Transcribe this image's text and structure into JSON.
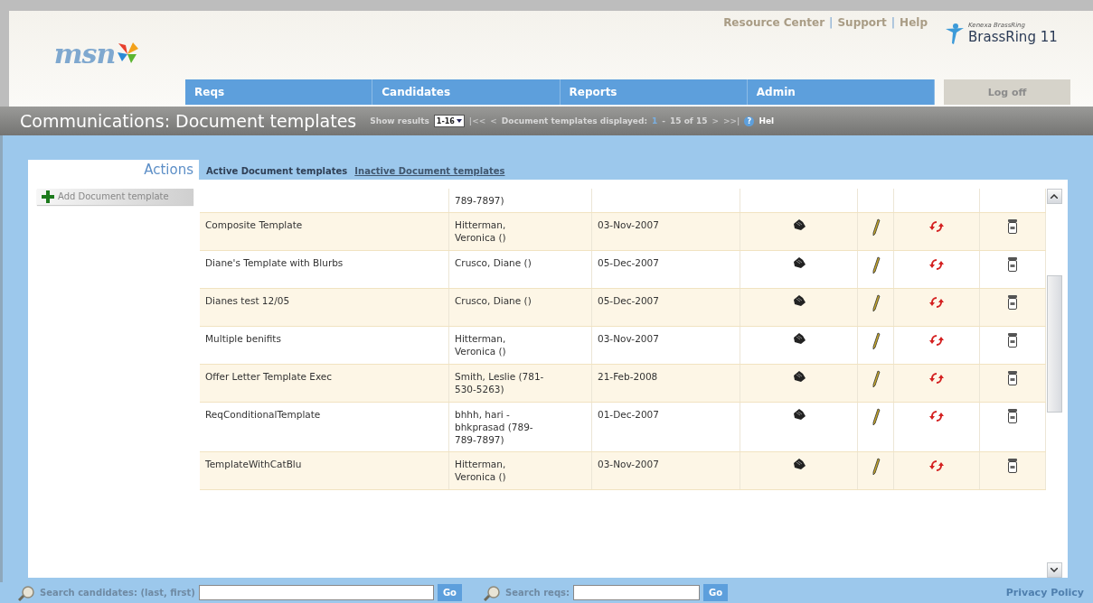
{
  "header": {
    "logo": "msn",
    "top_links": [
      {
        "label": "Resource Center",
        "separator": "|"
      },
      {
        "label": "Support",
        "separator": "|"
      },
      {
        "label": "Help"
      }
    ],
    "brand": {
      "tagline": "Kenexa BrassRing",
      "name": "BrassRing 11"
    },
    "nav": [
      {
        "label": "Reqs",
        "selected": false
      },
      {
        "label": "Candidates",
        "selected": false
      },
      {
        "label": "Reports",
        "selected": false
      },
      {
        "label": "Admin",
        "selected": false
      }
    ],
    "logoff": "Log off"
  },
  "title_bar": {
    "title": "Communications: Document templates",
    "show_results_label": "Show results",
    "show_results_value": "1-16",
    "first": "|<<",
    "prev": "<",
    "displayed_label": "Document templates displayed:",
    "range_start": "1",
    "range_sep": "-",
    "range_end": "15 of 15",
    "next": ">",
    "last": ">>|",
    "help_mark": "?",
    "help": "Hel"
  },
  "tabs": [
    {
      "label": "Actions",
      "kind": "heading"
    },
    {
      "label": "Active Document templates",
      "selected": true,
      "kind": "tab"
    },
    {
      "label": "Inactive Document templates",
      "selected": false,
      "kind": "tab"
    }
  ],
  "actions": [
    {
      "label": "Add Document template"
    }
  ],
  "table": {
    "partial_top": {
      "owner": "789-7897)"
    },
    "rows": [
      {
        "name": "Composite Template",
        "owner": "Hitterman, Veronica ()",
        "date": "03-Nov-2007"
      },
      {
        "name": "Diane's Template with Blurbs",
        "owner": "Crusco, Diane ()",
        "date": "05-Dec-2007"
      },
      {
        "name": "Dianes test 12/05",
        "owner": "Crusco, Diane ()",
        "date": "05-Dec-2007"
      },
      {
        "name": "Multiple benifits",
        "owner": "Hitterman, Veronica ()",
        "date": "03-Nov-2007"
      },
      {
        "name": "Offer Letter Template Exec",
        "owner": "Smith, Leslie (781-530-5263)",
        "date": "21-Feb-2008"
      },
      {
        "name": "ReqConditionalTemplate",
        "owner": "bhhh, hari - bhkprasad (789-789-7897)",
        "date": "01-Dec-2007"
      },
      {
        "name": "TemplateWithCatBlu",
        "owner": "Hitterman, Veronica ()",
        "date": "03-Nov-2007"
      }
    ]
  },
  "footer": {
    "search_candidates": {
      "label": "Search candidates: (last, first)",
      "button": "Go"
    },
    "search_reqs": {
      "label": "Search reqs:",
      "button": "Go"
    },
    "privacy": "Privacy Policy"
  }
}
